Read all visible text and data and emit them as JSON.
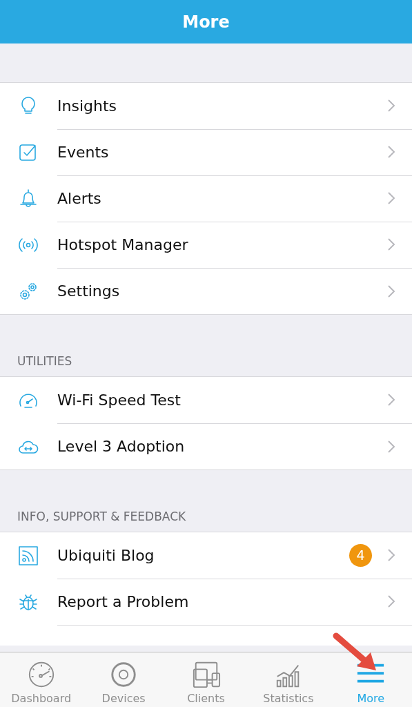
{
  "header": {
    "title": "More"
  },
  "sections": [
    {
      "items": [
        {
          "label": "Insights",
          "kind": "bulb"
        },
        {
          "label": "Events",
          "kind": "check"
        },
        {
          "label": "Alerts",
          "kind": "bell"
        },
        {
          "label": "Hotspot Manager",
          "kind": "signal"
        },
        {
          "label": "Settings",
          "kind": "gears"
        }
      ]
    },
    {
      "header": "UTILITIES",
      "items": [
        {
          "label": "Wi-Fi Speed Test",
          "kind": "gauge"
        },
        {
          "label": "Level 3 Adoption",
          "kind": "cloud"
        }
      ]
    },
    {
      "header": "INFO, SUPPORT & FEEDBACK",
      "items": [
        {
          "label": "Ubiquiti Blog",
          "kind": "rss",
          "badge": "4"
        },
        {
          "label": "Report a Problem",
          "kind": "bug"
        }
      ]
    }
  ],
  "tabs": [
    {
      "label": "Dashboard",
      "kind": "gauge",
      "selected": false
    },
    {
      "label": "Devices",
      "kind": "disc",
      "selected": false
    },
    {
      "label": "Clients",
      "kind": "devices",
      "selected": false
    },
    {
      "label": "Statistics",
      "kind": "stats",
      "selected": false
    },
    {
      "label": "More",
      "kind": "menu",
      "selected": true
    }
  ]
}
